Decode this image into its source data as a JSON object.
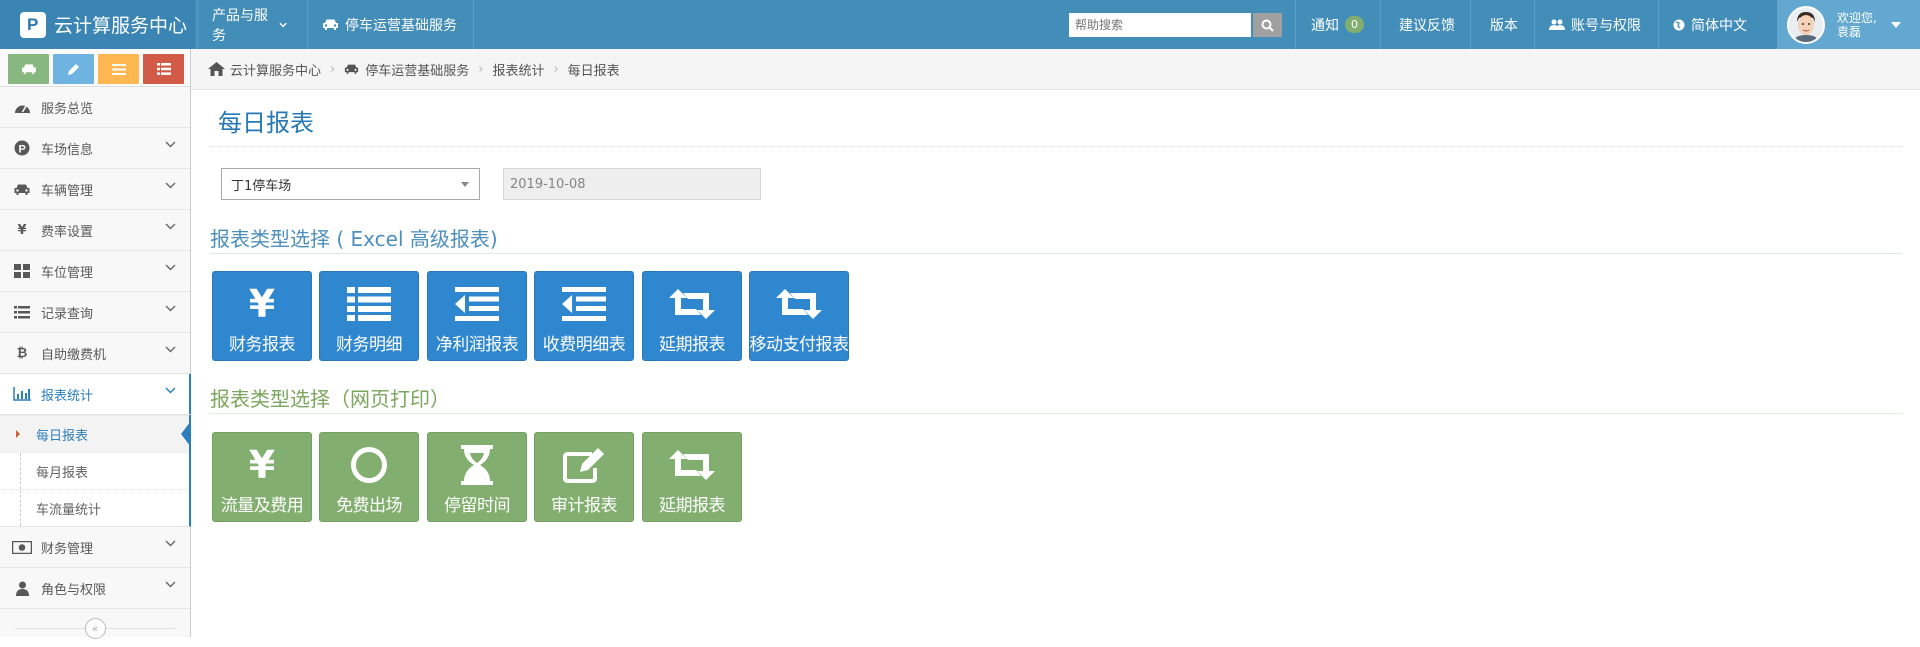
{
  "topbar": {
    "brand": "云计算服务中心",
    "products": "产品与服务",
    "service": "停车运营基础服务",
    "search_placeholder": "帮助搜索",
    "notify": "通知",
    "notify_count": "0",
    "feedback": "建议反馈",
    "version": "版本",
    "account": "账号与权限",
    "language": "简体中文",
    "welcome": "欢迎您,",
    "username": "袁磊"
  },
  "sidebar": {
    "shortcut_colors": [
      "#87b87f",
      "#6fb3e0",
      "#ffb752",
      "#d15b47"
    ],
    "items": [
      {
        "label": "服务总览",
        "icon": "dashboard-icon"
      },
      {
        "label": "车场信息",
        "icon": "parking-icon"
      },
      {
        "label": "车辆管理",
        "icon": "car-icon"
      },
      {
        "label": "费率设置",
        "icon": "yen-icon"
      },
      {
        "label": "车位管理",
        "icon": "grid-icon"
      },
      {
        "label": "记录查询",
        "icon": "list-icon"
      },
      {
        "label": "自助缴费机",
        "icon": "bitcoin-icon"
      },
      {
        "label": "报表统计",
        "icon": "bar-chart-icon"
      }
    ],
    "submenu": [
      "每日报表",
      "每月报表",
      "车流量统计"
    ],
    "items_after": [
      {
        "label": "财务管理",
        "icon": "money-icon"
      },
      {
        "label": "角色与权限",
        "icon": "user-icon"
      }
    ]
  },
  "breadcrumb": [
    "云计算服务中心",
    "停车运营基础服务",
    "报表统计",
    "每日报表"
  ],
  "page": {
    "title": "每日报表",
    "lot_select": "丁1停车场",
    "date_value": "2019-10-08"
  },
  "excel_section": {
    "title": "报表类型选择 ( Excel 高级报表)",
    "color": "#4c8fbd",
    "buttons": [
      {
        "label": "财务报表",
        "icon": "yen-icon"
      },
      {
        "label": "财务明细",
        "icon": "list-icon"
      },
      {
        "label": "净利润报表",
        "icon": "indent-icon"
      },
      {
        "label": "收费明细表",
        "icon": "indent-icon"
      },
      {
        "label": "延期报表",
        "icon": "retweet-icon"
      },
      {
        "label": "移动支付报表",
        "icon": "retweet-icon"
      }
    ]
  },
  "print_section": {
    "title": "报表类型选择（网页打印）",
    "color": "#7ba65d",
    "buttons": [
      {
        "label": "流量及费用",
        "icon": "yen-icon"
      },
      {
        "label": "免费出场",
        "icon": "circle-icon"
      },
      {
        "label": "停留时间",
        "icon": "hourglass-icon"
      },
      {
        "label": "审计报表",
        "icon": "edit-icon"
      },
      {
        "label": "延期报表",
        "icon": "retweet-icon"
      }
    ]
  }
}
